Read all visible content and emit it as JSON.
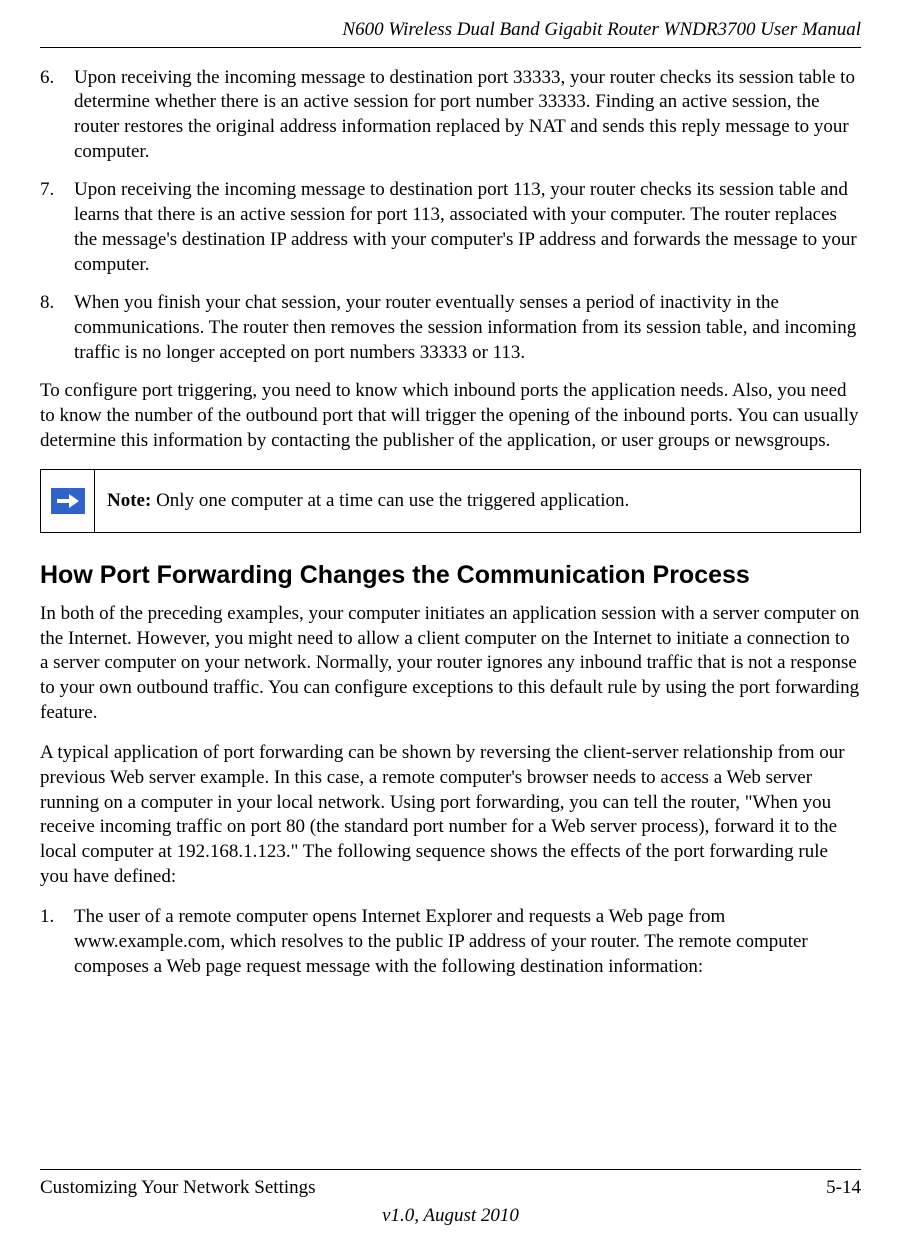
{
  "header": {
    "running_title": "N600 Wireless Dual Band Gigabit Router WNDR3700 User Manual"
  },
  "list1": [
    {
      "num": "6.",
      "text": "Upon receiving the incoming message to destination port 33333, your router checks its session table to determine whether there is an active session for port number 33333. Finding an active session, the router restores the original address information replaced by NAT and sends this reply message to your computer."
    },
    {
      "num": "7.",
      "text": "Upon receiving the incoming message to destination port 113, your router checks its session table and learns that there is an active session for port 113, associated with your computer. The router replaces the message's destination IP address with your computer's IP address and forwards the message to your computer."
    },
    {
      "num": "8.",
      "text": "When you finish your chat session, your router eventually senses a period of inactivity in the communications. The router then removes the session information from its session table, and incoming traffic is no longer accepted on port numbers 33333 or 113."
    }
  ],
  "para1": "To configure port triggering, you need to know which inbound ports the application needs. Also, you need to know the number of the outbound port that will trigger the opening of the inbound ports. You can usually determine this information by contacting the publisher of the application, or user groups or newsgroups.",
  "note": {
    "label": "Note:",
    "text": " Only one computer at a time can use the triggered application."
  },
  "section_heading": "How Port Forwarding Changes the Communication Process",
  "para2": "In both of the preceding examples, your computer initiates an application session with a server computer on the Internet. However, you might need to allow a client computer on the Internet to initiate a connection to a server computer on your network. Normally, your router ignores any inbound traffic that is not a response to your own outbound traffic. You can configure exceptions to this default rule by using the port forwarding feature.",
  "para3": "A typical application of port forwarding can be shown by reversing the client-server relationship from our previous Web server example. In this case, a remote computer's browser needs to access a Web server running on a computer in your local network. Using port forwarding, you can tell the router, \"When you receive incoming traffic on port 80 (the standard port number for a Web server process), forward it to the local computer at 192.168.1.123.\" The following sequence shows the effects of the port forwarding rule you have defined:",
  "list2": [
    {
      "num": "1.",
      "text": "The user of a remote computer opens Internet Explorer and requests a Web page from www.example.com, which resolves to the public IP address of your router. The remote computer composes a Web page request message with the following destination information:"
    }
  ],
  "footer": {
    "left": "Customizing Your Network Settings",
    "right": "5-14",
    "version": "v1.0, August 2010"
  }
}
